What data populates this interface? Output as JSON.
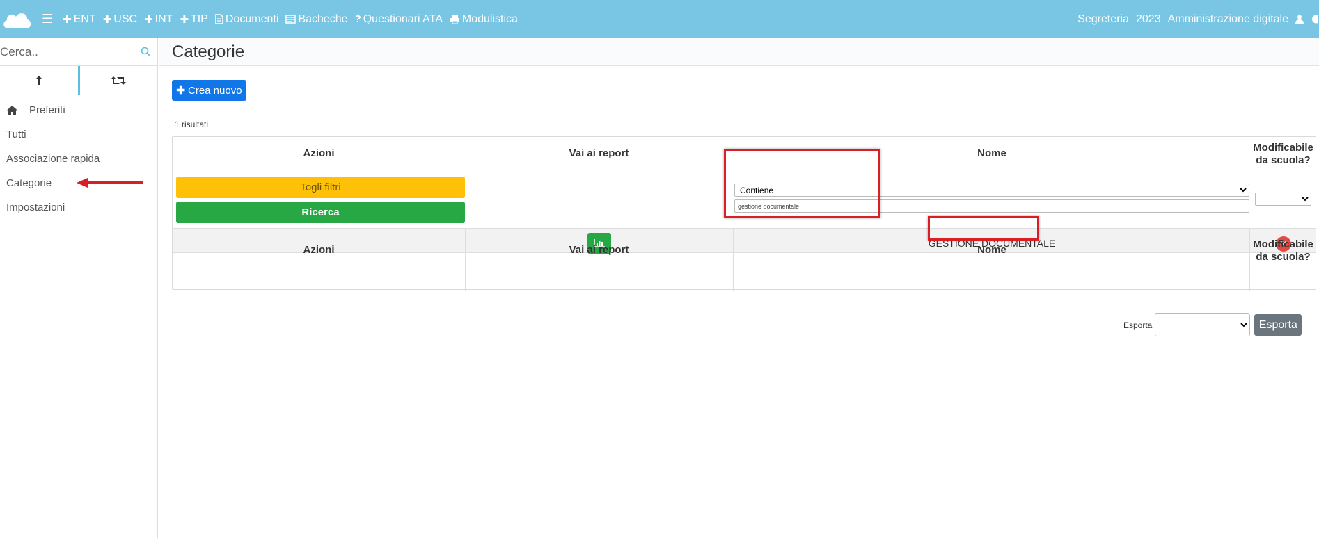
{
  "topbar": {
    "nav": [
      {
        "icon": "plus-icon",
        "label": "ENT"
      },
      {
        "icon": "plus-icon",
        "label": "USC"
      },
      {
        "icon": "plus-icon",
        "label": "INT"
      },
      {
        "icon": "plus-icon",
        "label": "TIP"
      },
      {
        "icon": "document-icon",
        "label": "Documenti"
      },
      {
        "icon": "board-icon",
        "label": "Bacheche"
      },
      {
        "icon": "question-icon",
        "label": "Questionari ATA"
      },
      {
        "icon": "printer-icon",
        "label": "Modulistica"
      }
    ],
    "right": {
      "office": "Segreteria",
      "year": "2023",
      "app": "Amministrazione digitale"
    }
  },
  "sidebar": {
    "search_placeholder": "Cerca..",
    "items": [
      {
        "label": "Preferiti"
      },
      {
        "label": "Tutti"
      },
      {
        "label": "Associazione rapida"
      },
      {
        "label": "Categorie"
      },
      {
        "label": "Impostazioni"
      }
    ]
  },
  "main": {
    "title": "Categorie",
    "create_label": "Crea nuovo",
    "results": "1 risultati",
    "columns": {
      "azioni": "Azioni",
      "report": "Vai ai report",
      "nome": "Nome",
      "mod_line1": "Modificabile",
      "mod_line2": "da scuola?"
    },
    "filters": {
      "clear_label": "Togli filtri",
      "search_label": "Ricerca",
      "operator": "Contiene",
      "value": "gestione documentale"
    },
    "rows": [
      {
        "nome": "GESTIONE DOCUMENTALE"
      }
    ],
    "export": {
      "label": "Esporta",
      "button": "Esporta"
    }
  },
  "colors": {
    "topbar": "#78c6e3",
    "primary": "#1177e8",
    "warning": "#fec107",
    "success": "#28a745",
    "danger": "#e24a43",
    "annotation": "#d91f26"
  }
}
